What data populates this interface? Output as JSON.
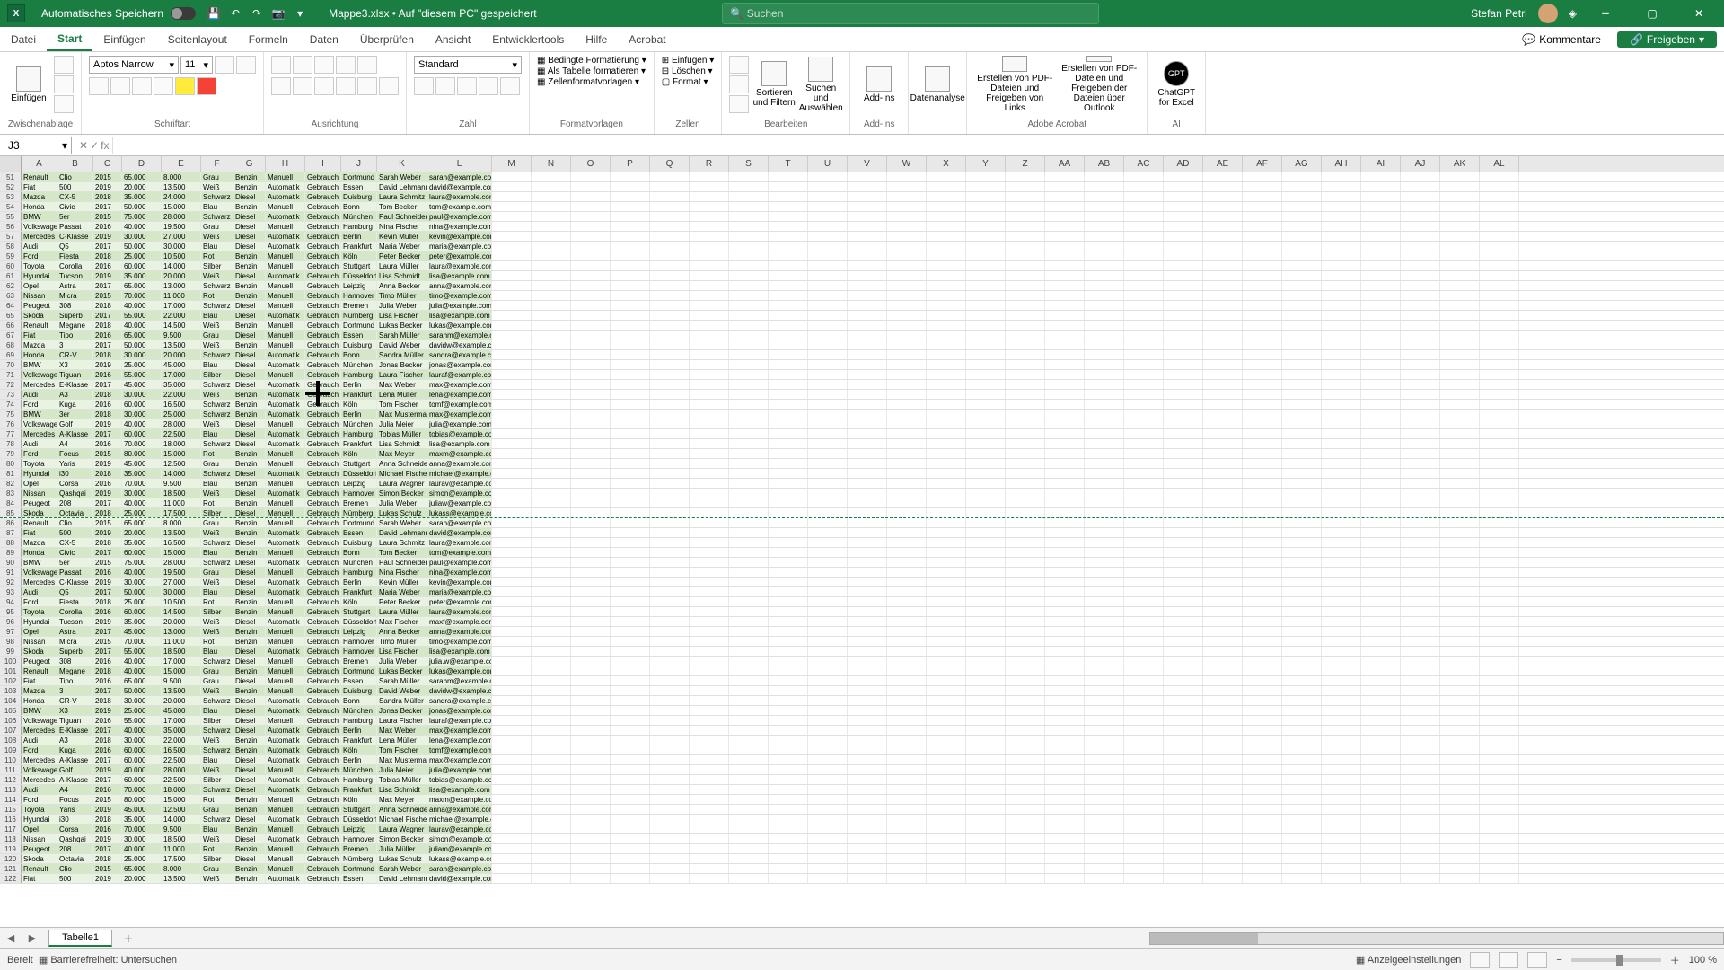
{
  "titlebar": {
    "autosave_label": "Automatisches Speichern",
    "doc_title": "Mappe3.xlsx • Auf \"diesem PC\" gespeichert",
    "search_placeholder": "Suchen",
    "user_name": "Stefan Petri"
  },
  "ribbon_tabs": {
    "items": [
      "Datei",
      "Start",
      "Einfügen",
      "Seitenlayout",
      "Formeln",
      "Daten",
      "Überprüfen",
      "Ansicht",
      "Entwicklertools",
      "Hilfe",
      "Acrobat"
    ],
    "active_index": 1,
    "comments": "Kommentare",
    "share": "Freigeben"
  },
  "ribbon": {
    "paste": "Einfügen",
    "clipboard_group": "Zwischenablage",
    "font_name": "Aptos Narrow",
    "font_size": "11",
    "font_group": "Schriftart",
    "align_group": "Ausrichtung",
    "number_format": "Standard",
    "number_group": "Zahl",
    "cond_fmt": "Bedingte Formatierung",
    "as_table": "Als Tabelle formatieren",
    "cell_styles": "Zellenformatvorlagen",
    "styles_group": "Formatvorlagen",
    "insert": "Einfügen",
    "delete": "Löschen",
    "format": "Format",
    "cells_group": "Zellen",
    "sort_filter": "Sortieren und Filtern",
    "find_select": "Suchen und Auswählen",
    "edit_group": "Bearbeiten",
    "addins": "Add-Ins",
    "addins_group": "Add-Ins",
    "data_analysis": "Datenanalyse",
    "pdf1": "Erstellen von PDF-Dateien und Freigeben von Links",
    "pdf2": "Erstellen von PDF-Dateien und Freigeben der Dateien über Outlook",
    "acrobat_group": "Adobe Acrobat",
    "chatgpt": "ChatGPT for Excel",
    "ai_group": "AI"
  },
  "formula_bar": {
    "name_box": "J3",
    "fx": "fx"
  },
  "columns": [
    "A",
    "B",
    "C",
    "D",
    "E",
    "F",
    "G",
    "H",
    "I",
    "J",
    "K",
    "L",
    "M",
    "N",
    "O",
    "P",
    "Q",
    "R",
    "S",
    "T",
    "U",
    "V",
    "W",
    "X",
    "Y",
    "Z",
    "AA",
    "AB",
    "AC",
    "AD",
    "AE",
    "AF",
    "AG",
    "AH",
    "AI",
    "AJ",
    "AK",
    "AL"
  ],
  "first_row": 51,
  "page_break_row": 85,
  "table": [
    [
      "Renault",
      "Clio",
      "2015",
      "65.000",
      "8.000",
      "Grau",
      "Benzin",
      "Manuell",
      "Gebrauch",
      "Dortmund",
      "Sarah Weber",
      "sarah@example.com"
    ],
    [
      "Fiat",
      "500",
      "2019",
      "20.000",
      "13.500",
      "Weiß",
      "Benzin",
      "Automatik",
      "Gebrauch",
      "Essen",
      "David Lehmann",
      "david@example.com"
    ],
    [
      "Mazda",
      "CX-5",
      "2018",
      "35.000",
      "24.000",
      "Schwarz",
      "Diesel",
      "Automatik",
      "Gebrauch",
      "Duisburg",
      "Laura Schmitz",
      "laura@example.com"
    ],
    [
      "Honda",
      "Civic",
      "2017",
      "50.000",
      "15.000",
      "Blau",
      "Benzin",
      "Manuell",
      "Gebrauch",
      "Bonn",
      "Tom Becker",
      "tom@example.com"
    ],
    [
      "BMW",
      "5er",
      "2015",
      "75.000",
      "28.000",
      "Schwarz",
      "Diesel",
      "Automatik",
      "Gebrauch",
      "München",
      "Paul Schneider",
      "paul@example.com"
    ],
    [
      "Volkswage",
      "Passat",
      "2016",
      "40.000",
      "19.500",
      "Grau",
      "Diesel",
      "Manuell",
      "Gebrauch",
      "Hamburg",
      "Nina Fischer",
      "nina@example.com"
    ],
    [
      "Mercedes",
      "C-Klasse",
      "2019",
      "30.000",
      "27.000",
      "Weiß",
      "Diesel",
      "Automatik",
      "Gebrauch",
      "Berlin",
      "Kevin Müller",
      "kevin@example.com"
    ],
    [
      "Audi",
      "Q5",
      "2017",
      "50.000",
      "30.000",
      "Blau",
      "Diesel",
      "Automatik",
      "Gebrauch",
      "Frankfurt",
      "Maria Weber",
      "maria@example.com"
    ],
    [
      "Ford",
      "Fiesta",
      "2018",
      "25.000",
      "10.500",
      "Rot",
      "Benzin",
      "Manuell",
      "Gebrauch",
      "Köln",
      "Peter Becker",
      "peter@example.com"
    ],
    [
      "Toyota",
      "Corolla",
      "2016",
      "60.000",
      "14.000",
      "Silber",
      "Benzin",
      "Manuell",
      "Gebrauch",
      "Stuttgart",
      "Laura Müller",
      "laura@example.com"
    ],
    [
      "Hyundai",
      "Tucson",
      "2019",
      "35.000",
      "20.000",
      "Weiß",
      "Diesel",
      "Automatik",
      "Gebrauch",
      "Düsseldorf",
      "Lisa Schmidt",
      "lisa@example.com"
    ],
    [
      "Opel",
      "Astra",
      "2017",
      "65.000",
      "13.000",
      "Schwarz",
      "Benzin",
      "Manuell",
      "Gebrauch",
      "Leipzig",
      "Anna Becker",
      "anna@example.com"
    ],
    [
      "Nissan",
      "Micra",
      "2015",
      "70.000",
      "11.000",
      "Rot",
      "Benzin",
      "Manuell",
      "Gebrauch",
      "Hannover",
      "Timo Müller",
      "timo@example.com"
    ],
    [
      "Peugeot",
      "308",
      "2018",
      "40.000",
      "17.000",
      "Schwarz",
      "Diesel",
      "Manuell",
      "Gebrauch",
      "Bremen",
      "Julia Weber",
      "julia@example.com"
    ],
    [
      "Skoda",
      "Superb",
      "2017",
      "55.000",
      "22.000",
      "Blau",
      "Diesel",
      "Automatik",
      "Gebrauch",
      "Nürnberg",
      "Lisa Fischer",
      "lisa@example.com"
    ],
    [
      "Renault",
      "Megane",
      "2018",
      "40.000",
      "14.500",
      "Weiß",
      "Benzin",
      "Manuell",
      "Gebrauch",
      "Dortmund",
      "Lukas Becker",
      "lukas@example.com"
    ],
    [
      "Fiat",
      "Tipo",
      "2016",
      "65.000",
      "9.500",
      "Grau",
      "Diesel",
      "Manuell",
      "Gebrauch",
      "Essen",
      "Sarah Müller",
      "sarahm@example.com"
    ],
    [
      "Mazda",
      "3",
      "2017",
      "50.000",
      "13.500",
      "Weiß",
      "Benzin",
      "Manuell",
      "Gebrauch",
      "Duisburg",
      "David Weber",
      "davidw@example.com"
    ],
    [
      "Honda",
      "CR-V",
      "2018",
      "30.000",
      "20.000",
      "Schwarz",
      "Diesel",
      "Automatik",
      "Gebrauch",
      "Bonn",
      "Sandra Müller",
      "sandra@example.com"
    ],
    [
      "BMW",
      "X3",
      "2019",
      "25.000",
      "45.000",
      "Blau",
      "Diesel",
      "Automatik",
      "Gebrauch",
      "München",
      "Jonas Becker",
      "jonas@example.com"
    ],
    [
      "Volkswage",
      "Tiguan",
      "2016",
      "55.000",
      "17.000",
      "Silber",
      "Diesel",
      "Manuell",
      "Gebrauch",
      "Hamburg",
      "Laura Fischer",
      "lauraf@example.com"
    ],
    [
      "Mercedes",
      "E-Klasse",
      "2017",
      "45.000",
      "35.000",
      "Schwarz",
      "Diesel",
      "Automatik",
      "Gebrauch",
      "Berlin",
      "Max Weber",
      "max@example.com"
    ],
    [
      "Audi",
      "A3",
      "2018",
      "30.000",
      "22.000",
      "Weiß",
      "Benzin",
      "Automatik",
      "Gebrauch",
      "Frankfurt",
      "Lena Müller",
      "lena@example.com"
    ],
    [
      "Ford",
      "Kuga",
      "2016",
      "60.000",
      "16.500",
      "Schwarz",
      "Benzin",
      "Automatik",
      "Gebrauch",
      "Köln",
      "Tom Fischer",
      "tomf@example.com"
    ],
    [
      "BMW",
      "3er",
      "2018",
      "30.000",
      "25.000",
      "Schwarz",
      "Benzin",
      "Automatik",
      "Gebrauch",
      "Berlin",
      "Max Musterma",
      "max@example.com"
    ],
    [
      "Volkswage",
      "Golf",
      "2019",
      "40.000",
      "28.000",
      "Weiß",
      "Diesel",
      "Manuell",
      "Gebrauch",
      "München",
      "Julia Meier",
      "julia@example.com"
    ],
    [
      "Mercedes",
      "A-Klasse",
      "2017",
      "60.000",
      "22.500",
      "Blau",
      "Diesel",
      "Automatik",
      "Gebrauch",
      "Hamburg",
      "Tobias Müller",
      "tobias@example.com"
    ],
    [
      "Audi",
      "A4",
      "2016",
      "70.000",
      "18.000",
      "Schwarz",
      "Diesel",
      "Automatik",
      "Gebrauch",
      "Frankfurt",
      "Lisa Schmidt",
      "lisa@example.com"
    ],
    [
      "Ford",
      "Focus",
      "2015",
      "80.000",
      "15.000",
      "Rot",
      "Benzin",
      "Manuell",
      "Gebrauch",
      "Köln",
      "Max Meyer",
      "maxm@example.com"
    ],
    [
      "Toyota",
      "Yaris",
      "2019",
      "45.000",
      "12.500",
      "Grau",
      "Benzin",
      "Manuell",
      "Gebrauch",
      "Stuttgart",
      "Anna Schneider",
      "anna@example.com"
    ],
    [
      "Hyundai",
      "i30",
      "2018",
      "35.000",
      "14.000",
      "Schwarz",
      "Diesel",
      "Automatik",
      "Gebrauch",
      "Düsseldorf",
      "Michael Fischer",
      "michael@example.com"
    ],
    [
      "Opel",
      "Corsa",
      "2016",
      "70.000",
      "9.500",
      "Blau",
      "Benzin",
      "Manuell",
      "Gebrauch",
      "Leipzig",
      "Laura Wagner",
      "laurav@example.com"
    ],
    [
      "Nissan",
      "Qashqai",
      "2019",
      "30.000",
      "18.500",
      "Weiß",
      "Diesel",
      "Automatik",
      "Gebrauch",
      "Hannover",
      "Simon Becker",
      "simon@example.com"
    ],
    [
      "Peugeot",
      "208",
      "2017",
      "40.000",
      "11.000",
      "Rot",
      "Benzin",
      "Manuell",
      "Gebrauch",
      "Bremen",
      "Julia Weber",
      "juliaw@example.com"
    ],
    [
      "Skoda",
      "Octavia",
      "2018",
      "25.000",
      "17.500",
      "Silber",
      "Diesel",
      "Manuell",
      "Gebrauch",
      "Nürnberg",
      "Lukas Schulz",
      "lukass@example.com"
    ],
    [
      "Renault",
      "Clio",
      "2015",
      "65.000",
      "8.000",
      "Grau",
      "Benzin",
      "Manuell",
      "Gebrauch",
      "Dortmund",
      "Sarah Weber",
      "sarah@example.com"
    ],
    [
      "Fiat",
      "500",
      "2019",
      "20.000",
      "13.500",
      "Weiß",
      "Benzin",
      "Automatik",
      "Gebrauch",
      "Essen",
      "David Lehmann",
      "david@example.com"
    ],
    [
      "Mazda",
      "CX-5",
      "2018",
      "35.000",
      "16.500",
      "Schwarz",
      "Diesel",
      "Automatik",
      "Gebrauch",
      "Duisburg",
      "Laura Schmitz",
      "laura@example.com"
    ],
    [
      "Honda",
      "Civic",
      "2017",
      "60.000",
      "15.000",
      "Blau",
      "Benzin",
      "Manuell",
      "Gebrauch",
      "Bonn",
      "Tom Becker",
      "tom@example.com"
    ],
    [
      "BMW",
      "5er",
      "2015",
      "75.000",
      "28.000",
      "Schwarz",
      "Diesel",
      "Automatik",
      "Gebrauch",
      "München",
      "Paul Schneider",
      "paul@example.com"
    ],
    [
      "Volkswage",
      "Passat",
      "2016",
      "40.000",
      "19.500",
      "Grau",
      "Diesel",
      "Manuell",
      "Gebrauch",
      "Hamburg",
      "Nina Fischer",
      "nina@example.com"
    ],
    [
      "Mercedes",
      "C-Klasse",
      "2019",
      "30.000",
      "27.000",
      "Weiß",
      "Diesel",
      "Automatik",
      "Gebrauch",
      "Berlin",
      "Kevin Müller",
      "kevin@example.com"
    ],
    [
      "Audi",
      "Q5",
      "2017",
      "50.000",
      "30.000",
      "Blau",
      "Diesel",
      "Automatik",
      "Gebrauch",
      "Frankfurt",
      "Maria Weber",
      "maria@example.com"
    ],
    [
      "Ford",
      "Fiesta",
      "2018",
      "25.000",
      "10.500",
      "Rot",
      "Benzin",
      "Manuell",
      "Gebrauch",
      "Köln",
      "Peter Becker",
      "peter@example.com"
    ],
    [
      "Toyota",
      "Corolla",
      "2016",
      "60.000",
      "14.500",
      "Silber",
      "Benzin",
      "Manuell",
      "Gebrauch",
      "Stuttgart",
      "Laura Müller",
      "laura@example.com"
    ],
    [
      "Hyundai",
      "Tucson",
      "2019",
      "35.000",
      "20.000",
      "Weiß",
      "Diesel",
      "Automatik",
      "Gebrauch",
      "Düsseldorf",
      "Max Fischer",
      "maxf@example.com"
    ],
    [
      "Opel",
      "Astra",
      "2017",
      "45.000",
      "13.000",
      "Weiß",
      "Benzin",
      "Manuell",
      "Gebrauch",
      "Leipzig",
      "Anna Becker",
      "anna@example.com"
    ],
    [
      "Nissan",
      "Micra",
      "2015",
      "70.000",
      "11.000",
      "Rot",
      "Benzin",
      "Manuell",
      "Gebrauch",
      "Hannover",
      "Timo Müller",
      "timo@example.com"
    ],
    [
      "Skoda",
      "Superb",
      "2017",
      "55.000",
      "18.500",
      "Blau",
      "Diesel",
      "Automatik",
      "Gebrauch",
      "Hannover",
      "Lisa Fischer",
      "lisa@example.com"
    ],
    [
      "Peugeot",
      "308",
      "2016",
      "40.000",
      "17.000",
      "Schwarz",
      "Diesel",
      "Manuell",
      "Gebrauch",
      "Bremen",
      "Julia Weber",
      "julia.w@example.com"
    ],
    [
      "Renault",
      "Megane",
      "2018",
      "40.000",
      "15.000",
      "Grau",
      "Benzin",
      "Manuell",
      "Gebrauch",
      "Dortmund",
      "Lukas Becker",
      "lukas@example.com"
    ],
    [
      "Fiat",
      "Tipo",
      "2016",
      "65.000",
      "9.500",
      "Grau",
      "Diesel",
      "Manuell",
      "Gebrauch",
      "Essen",
      "Sarah Müller",
      "sarahm@example.com"
    ],
    [
      "Mazda",
      "3",
      "2017",
      "50.000",
      "13.500",
      "Weiß",
      "Benzin",
      "Manuell",
      "Gebrauch",
      "Duisburg",
      "David Weber",
      "davidw@example.com"
    ],
    [
      "Honda",
      "CR-V",
      "2018",
      "30.000",
      "20.000",
      "Schwarz",
      "Diesel",
      "Automatik",
      "Gebrauch",
      "Bonn",
      "Sandra Müller",
      "sandra@example.com"
    ],
    [
      "BMW",
      "X3",
      "2019",
      "25.000",
      "45.000",
      "Blau",
      "Diesel",
      "Automatik",
      "Gebrauch",
      "München",
      "Jonas Becker",
      "jonas@example.com"
    ],
    [
      "Volkswage",
      "Tiguan",
      "2016",
      "55.000",
      "17.000",
      "Silber",
      "Diesel",
      "Manuell",
      "Gebrauch",
      "Hamburg",
      "Laura Fischer",
      "lauraf@example.com"
    ],
    [
      "Mercedes",
      "E-Klasse",
      "2017",
      "40.000",
      "35.000",
      "Schwarz",
      "Diesel",
      "Automatik",
      "Gebrauch",
      "Berlin",
      "Max Weber",
      "max@example.com"
    ],
    [
      "Audi",
      "A3",
      "2018",
      "30.000",
      "22.000",
      "Weiß",
      "Benzin",
      "Automatik",
      "Gebrauch",
      "Frankfurt",
      "Lena Müller",
      "lena@example.com"
    ],
    [
      "Ford",
      "Kuga",
      "2016",
      "60.000",
      "16.500",
      "Schwarz",
      "Benzin",
      "Automatik",
      "Gebrauch",
      "Köln",
      "Tom Fischer",
      "tomf@example.com"
    ],
    [
      "Mercedes",
      "A-Klasse",
      "2017",
      "60.000",
      "22.500",
      "Blau",
      "Diesel",
      "Automatik",
      "Gebrauch",
      "Berlin",
      "Max Musterma",
      "max@example.com"
    ],
    [
      "Volkswage",
      "Golf",
      "2019",
      "40.000",
      "28.000",
      "Weiß",
      "Diesel",
      "Manuell",
      "Gebrauch",
      "München",
      "Julia Meier",
      "julia@example.com"
    ],
    [
      "Mercedes",
      "A-Klasse",
      "2017",
      "60.000",
      "22.500",
      "Silber",
      "Diesel",
      "Automatik",
      "Gebrauch",
      "Hamburg",
      "Tobias Müller",
      "tobias@example.com"
    ],
    [
      "Audi",
      "A4",
      "2016",
      "70.000",
      "18.000",
      "Schwarz",
      "Diesel",
      "Automatik",
      "Gebrauch",
      "Frankfurt",
      "Lisa Schmidt",
      "lisa@example.com"
    ],
    [
      "Ford",
      "Focus",
      "2015",
      "80.000",
      "15.000",
      "Rot",
      "Benzin",
      "Manuell",
      "Gebrauch",
      "Köln",
      "Max Meyer",
      "maxm@example.com"
    ],
    [
      "Toyota",
      "Yaris",
      "2019",
      "45.000",
      "12.500",
      "Grau",
      "Benzin",
      "Manuell",
      "Gebrauch",
      "Stuttgart",
      "Anna Schneider",
      "anna@example.com"
    ],
    [
      "Hyundai",
      "i30",
      "2018",
      "35.000",
      "14.000",
      "Schwarz",
      "Diesel",
      "Automatik",
      "Gebrauch",
      "Düsseldorf",
      "Michael Fischer",
      "michael@example.com"
    ],
    [
      "Opel",
      "Corsa",
      "2016",
      "70.000",
      "9.500",
      "Blau",
      "Benzin",
      "Manuell",
      "Gebrauch",
      "Leipzig",
      "Laura Wagner",
      "laurav@example.com"
    ],
    [
      "Nissan",
      "Qashqai",
      "2019",
      "30.000",
      "18.500",
      "Weiß",
      "Diesel",
      "Automatik",
      "Gebrauch",
      "Hannover",
      "Simon Becker",
      "simon@example.com"
    ],
    [
      "Peugeot",
      "208",
      "2017",
      "40.000",
      "11.000",
      "Rot",
      "Benzin",
      "Manuell",
      "Gebrauch",
      "Bremen",
      "Julia Müller",
      "juliam@example.com"
    ],
    [
      "Skoda",
      "Octavia",
      "2018",
      "25.000",
      "17.500",
      "Silber",
      "Diesel",
      "Manuell",
      "Gebrauch",
      "Nürnberg",
      "Lukas Schulz",
      "lukass@example.com"
    ],
    [
      "Renault",
      "Clio",
      "2015",
      "65.000",
      "8.000",
      "Grau",
      "Benzin",
      "Manuell",
      "Gebrauch",
      "Dortmund",
      "Sarah Weber",
      "sarah@example.com"
    ],
    [
      "Fiat",
      "500",
      "2019",
      "20.000",
      "13.500",
      "Weiß",
      "Benzin",
      "Automatik",
      "Gebrauch",
      "Essen",
      "David Lehmann",
      "david@example.com"
    ]
  ],
  "sheet_tabs": {
    "active": "Tabelle1"
  },
  "statusbar": {
    "ready": "Bereit",
    "accessibility": "Barrierefreiheit: Untersuchen",
    "display_settings": "Anzeigeeinstellungen",
    "zoom": "100 %"
  }
}
